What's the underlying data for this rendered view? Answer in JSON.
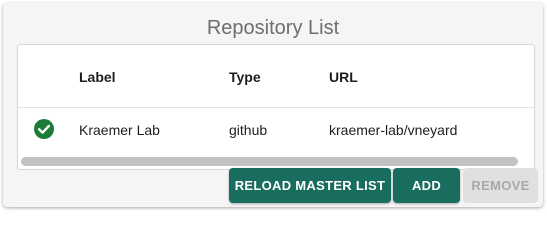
{
  "title": "Repository List",
  "table": {
    "columns": {
      "label": "Label",
      "type": "Type",
      "url": "URL"
    },
    "rows": [
      {
        "status_icon": "check-circle-icon",
        "label": "Kraemer Lab",
        "type": "github",
        "url": "kraemer-lab/vneyard"
      }
    ]
  },
  "buttons": {
    "reload": "RELOAD MASTER LIST",
    "add": "ADD",
    "remove": "REMOVE"
  },
  "colors": {
    "primary": "#186d5e",
    "status_ok": "#1e7c3a",
    "disabled_bg": "#e0e0e0",
    "disabled_text": "#a8a8a8"
  }
}
